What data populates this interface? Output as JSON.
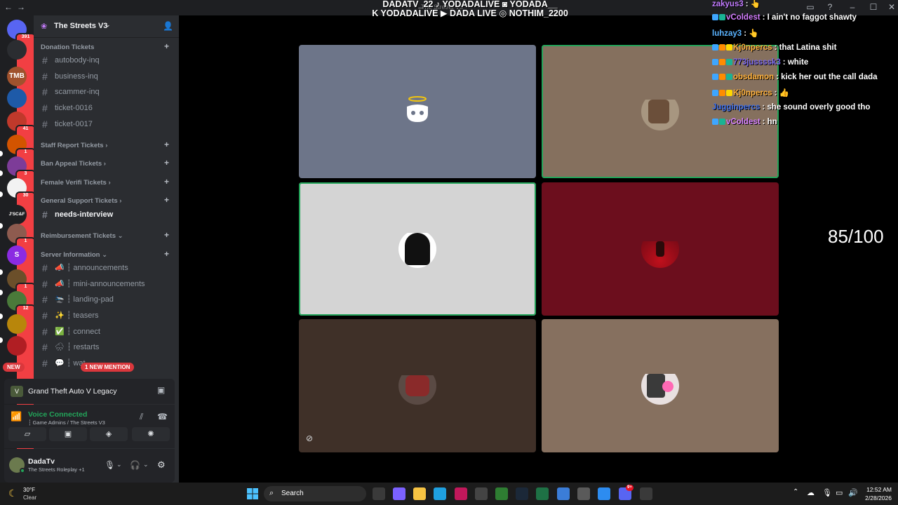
{
  "window": {
    "back": "←",
    "forward": "→",
    "center_title": "The Streets V3",
    "controls": {
      "minimize": "–",
      "maximize": "☐",
      "close": "✕"
    }
  },
  "guilds": [
    {
      "name": "discord-home",
      "badge": "391",
      "color": "#5865f2"
    },
    {
      "name": "hourglass",
      "badge": "",
      "color": "#2b2d31"
    },
    {
      "name": "tmb",
      "badge": "",
      "color": "#a0522d",
      "text": "TMB"
    },
    {
      "name": "blue-orb",
      "badge": "",
      "color": "#1e5aa8"
    },
    {
      "name": "red-server",
      "badge": "41",
      "color": "#c0392b"
    },
    {
      "name": "orange-server",
      "badge": "1",
      "color": "#d35400"
    },
    {
      "name": "purple-server",
      "badge": "3",
      "color": "#7d3c98"
    },
    {
      "name": "white-server",
      "badge": "30",
      "color": "#f2f2f2"
    },
    {
      "name": "jscf",
      "badge": "",
      "color": "#1e1f22",
      "text": "J'SC&F"
    },
    {
      "name": "portrait",
      "badge": "1",
      "color": "#8e5b4f"
    },
    {
      "name": "s-logo",
      "badge": "",
      "color": "#8b2be2",
      "text": "S"
    },
    {
      "name": "gta-server",
      "badge": "1",
      "color": "#6b4f2a"
    },
    {
      "name": "game-server",
      "badge": "12",
      "color": "#4a7a3a"
    },
    {
      "name": "gold-server",
      "badge": "",
      "color": "#b8860b"
    },
    {
      "name": "red-ring",
      "badge": "",
      "color": "#b01e23"
    }
  ],
  "new_badge": "NEW",
  "server": {
    "name": "The Streets V3"
  },
  "categories": [
    {
      "label": "Donation Tickets",
      "plus": "+"
    },
    {
      "label": "Staff Report Tickets ›",
      "plus": "+"
    },
    {
      "label": "Ban Appeal Tickets ›",
      "plus": "+"
    },
    {
      "label": "Female Verifi Tickets ›",
      "plus": "+"
    },
    {
      "label": "General Support Tickets ›",
      "plus": "+"
    },
    {
      "label": "Reimbursement Tickets ⌄",
      "plus": "+"
    },
    {
      "label": "Server Information ⌄",
      "plus": "+"
    }
  ],
  "channels": [
    {
      "label": "autobody-inq"
    },
    {
      "label": "business-inq"
    },
    {
      "label": "scammer-inq"
    },
    {
      "label": "ticket-0016"
    },
    {
      "label": "ticket-0017"
    },
    {
      "label": "needs-interview"
    },
    {
      "label": "📣 ┆ announcements"
    },
    {
      "label": "📣 ┆ mini-announcements"
    },
    {
      "label": "🛬 ┆ landing-pad"
    },
    {
      "label": "✨ ┆ teasers"
    },
    {
      "label": "✅ ┆ connect"
    },
    {
      "label": "🌧 ┆ restarts"
    },
    {
      "label": "💬 ┆ wat"
    }
  ],
  "new_mention": "1 NEW MENTION",
  "activity": {
    "game": "Grand Theft Auto V Legacy"
  },
  "voice": {
    "status": "Voice Connected",
    "location": "┆ Game Admins / The Streets V3",
    "colors": {
      "ok": "#23a55a"
    }
  },
  "user": {
    "name": "DadaTv",
    "activity": "The Streets Roleplay +1"
  },
  "stream_overlay": {
    "line1": "DADATV_22 ♪ YODADALIVE ◙ YODADA__",
    "line2": "K YODADALIVE ▶ DADA LIVE ◎ NOTHIM_2200"
  },
  "tiles": [
    {
      "name": "tile-discord-default",
      "bg": "#6d7589",
      "speaking": false
    },
    {
      "name": "tile-user-2",
      "bg": "#85705e",
      "speaking": true
    },
    {
      "name": "tile-user-3",
      "bg": "#d4d4d4",
      "speaking": true
    },
    {
      "name": "tile-user-4",
      "bg": "#6c0e1d",
      "speaking": false
    },
    {
      "name": "tile-user-5",
      "bg": "#3f3028",
      "speaking": false
    },
    {
      "name": "tile-user-6",
      "bg": "#86705f",
      "speaking": false
    }
  ],
  "chat": [
    {
      "user": "zakyus3",
      "text": ": 👆",
      "color": "#c27bff",
      "badges": []
    },
    {
      "user": "vColdest",
      "text": ": I ain't no faggot shawty",
      "color": "#d580ff",
      "badges": [
        "#3ea6ff",
        "#1ab394"
      ]
    },
    {
      "user": "luhzay3",
      "text": ": 👆",
      "color": "#5ab3ff",
      "badges": []
    },
    {
      "user": "Kj0npercs",
      "text": ": that Latina shit",
      "color": "#ffb13b",
      "badges": [
        "#3ea6ff",
        "#ff8c00",
        "#ffd700"
      ]
    },
    {
      "user": "773jussssk3",
      "text": ": white",
      "color": "#7b68ee",
      "badges": [
        "#3ea6ff",
        "#ff8c00",
        "#1ab394"
      ]
    },
    {
      "user": "obsdamon",
      "text": ": kick her out the call dada",
      "color": "#ffb13b",
      "badges": [
        "#3ea6ff",
        "#ff8c00",
        "#1ab394"
      ]
    },
    {
      "user": "Kj0npercs",
      "text": ": 👍",
      "color": "#ffb13b",
      "badges": [
        "#3ea6ff",
        "#ff8c00",
        "#ffd700"
      ]
    },
    {
      "user": "Jugginpercs",
      "text": ": she sound overly good tho",
      "color": "#3f6fe8",
      "badges": []
    },
    {
      "user": "vColdest",
      "text": ": hn",
      "color": "#d580ff",
      "badges": [
        "#3ea6ff",
        "#1ab394"
      ]
    }
  ],
  "score": "85/100",
  "taskbar": {
    "weather_temp": "30°F",
    "weather_desc": "Clear",
    "search": "Search",
    "time": "12:52 AM",
    "date": "2/28/2026",
    "discord_badge": "9+"
  }
}
